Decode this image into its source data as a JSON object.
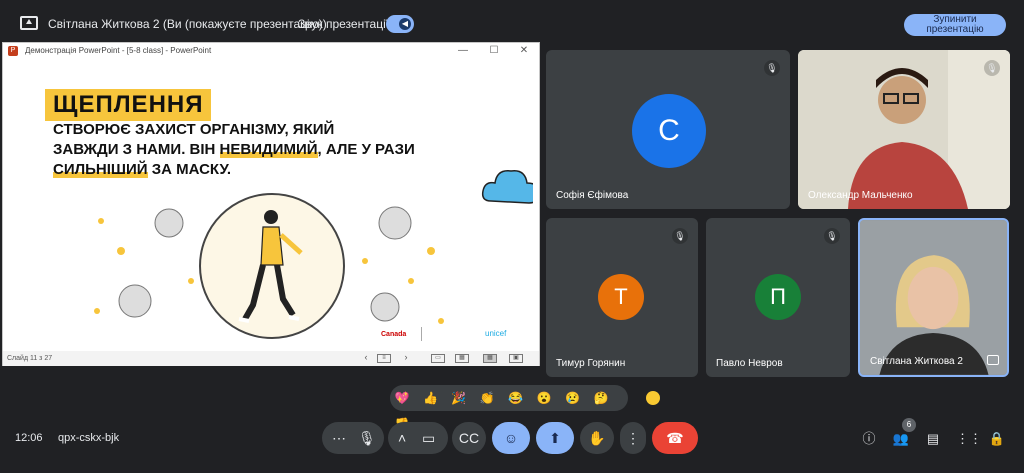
{
  "topbar": {
    "title": "Світлана Житкова 2 (Ви (покажуєте презентацію))",
    "audio_label": "Звук презентації",
    "stop_line1": "Зупинити",
    "stop_line2": "презентацію"
  },
  "ppt": {
    "window_title": "Демонстрація PowerPoint - [5-8 class] - PowerPoint",
    "slide_heading": "ЩЕПЛЕННЯ",
    "slide_line1": "СТВОРЮЄ ЗАХИСТ ОРГАНІЗМУ, ЯКИЙ",
    "slide_line2a": "ЗАВЖДИ З НАМИ. ВІН ",
    "slide_line2b": "НЕВИДИМИЙ",
    "slide_line2c": ", АЛЕ У РАЗИ",
    "slide_line3a": "СИЛЬНІШИЙ",
    "slide_line3b": " ЗА МАСКУ.",
    "status": "Слайд 11 з 27",
    "logo_canada": "Canada",
    "logo_unicef": "unicef"
  },
  "participants": [
    {
      "name": "Софія Єфімова",
      "initial": "С",
      "color": "#1a73e8"
    },
    {
      "name": "Олександр Мальченко",
      "initial": "",
      "color": ""
    },
    {
      "name": "Тимур Горянин",
      "initial": "Т",
      "color": "#e8710a"
    },
    {
      "name": "Павло Невров",
      "initial": "П",
      "color": "#188038"
    },
    {
      "name": "Світлана Житкова 2",
      "initial": "",
      "color": ""
    }
  ],
  "reactions": [
    "💖",
    "👍",
    "🎉",
    "👏",
    "😂",
    "😮",
    "😢",
    "🤔",
    "👎"
  ],
  "bottom": {
    "time": "12:06",
    "meeting_code": "qpx-cskx-bjk",
    "people_count": "6"
  }
}
